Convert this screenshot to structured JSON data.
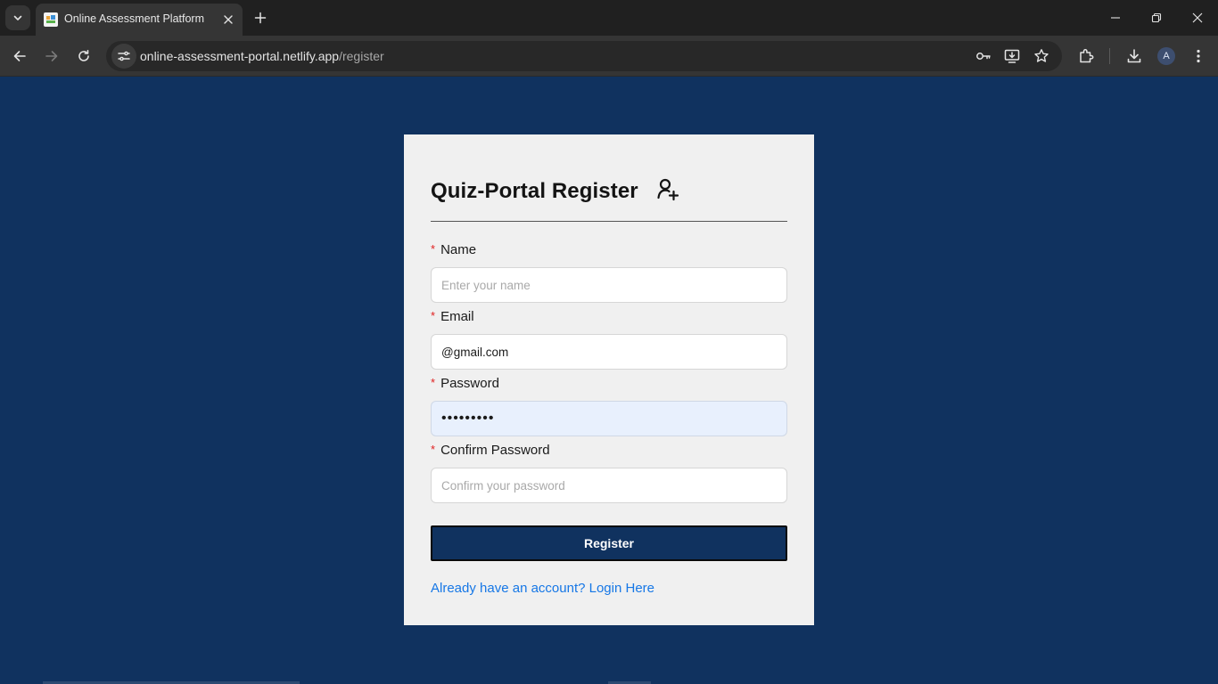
{
  "browser": {
    "tab_title": "Online Assessment Platform",
    "url_host": "online-assessment-portal.netlify.app",
    "url_path": "/register",
    "profile_initial": "A"
  },
  "form": {
    "title": "Quiz-Portal Register",
    "required_mark": "*",
    "name_label": "Name",
    "name_placeholder": "Enter your name",
    "name_value": "",
    "email_label": "Email",
    "email_value": "@gmail.com",
    "password_label": "Password",
    "password_value": "•••••••••",
    "confirm_label": "Confirm Password",
    "confirm_placeholder": "Confirm your password",
    "confirm_value": "",
    "submit_label": "Register",
    "login_link": "Already have an account? Login Here"
  },
  "colors": {
    "page_background": "#10325f",
    "card_background": "#f0f0f0",
    "button_background": "#10325f",
    "link": "#1677e6",
    "required": "#e02020",
    "autofill": "#e8f0fd"
  }
}
